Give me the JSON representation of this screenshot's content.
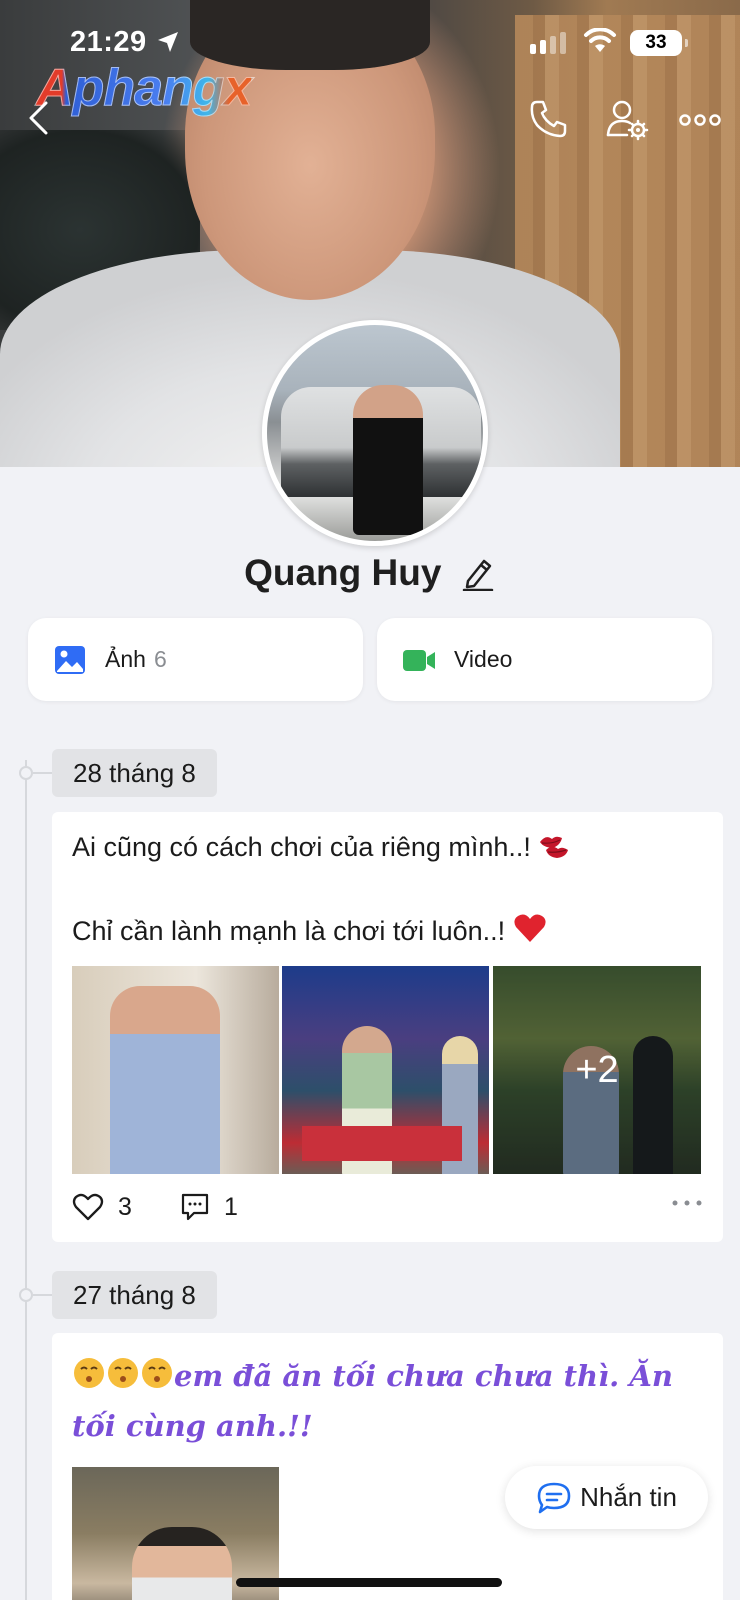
{
  "status_bar": {
    "time": "21:29",
    "battery": "33",
    "location_icon": "location-arrow-icon",
    "signal_icon": "cellular-signal-icon",
    "wifi_icon": "wifi-icon"
  },
  "watermark": "Aphangx",
  "header": {
    "back_icon": "chevron-left-icon",
    "call_icon": "phone-icon",
    "settings_icon": "profile-settings-icon",
    "more_icon": "more-horizontal-icon"
  },
  "profile": {
    "name": "Quang Huy",
    "edit_icon": "pencil-icon"
  },
  "media": {
    "photos": {
      "label": "Ảnh",
      "count": "6",
      "icon": "image-icon"
    },
    "videos": {
      "label": "Video",
      "icon": "video-camera-icon"
    }
  },
  "posts": [
    {
      "date": "28 tháng 8",
      "line1": "Ai cũng có cách chơi của riêng mình..!",
      "line2": "Chỉ cần lành mạnh là chơi tới luôn..!",
      "extra_photos": "+2",
      "likes": "3",
      "comments": "1"
    },
    {
      "date": "27 tháng 8",
      "text": "em đã ăn tối chưa chưa thì. Ăn tối cùng anh.!!"
    }
  ],
  "chat_button": {
    "label": "Nhắn tin",
    "icon": "chat-bubble-icon"
  },
  "colors": {
    "accent": "#7a4fd8",
    "photo_icon": "#2f6cf5",
    "video_icon": "#34b35a",
    "chat_icon": "#1f6ff0",
    "heart_emoji": "#e0232e"
  }
}
